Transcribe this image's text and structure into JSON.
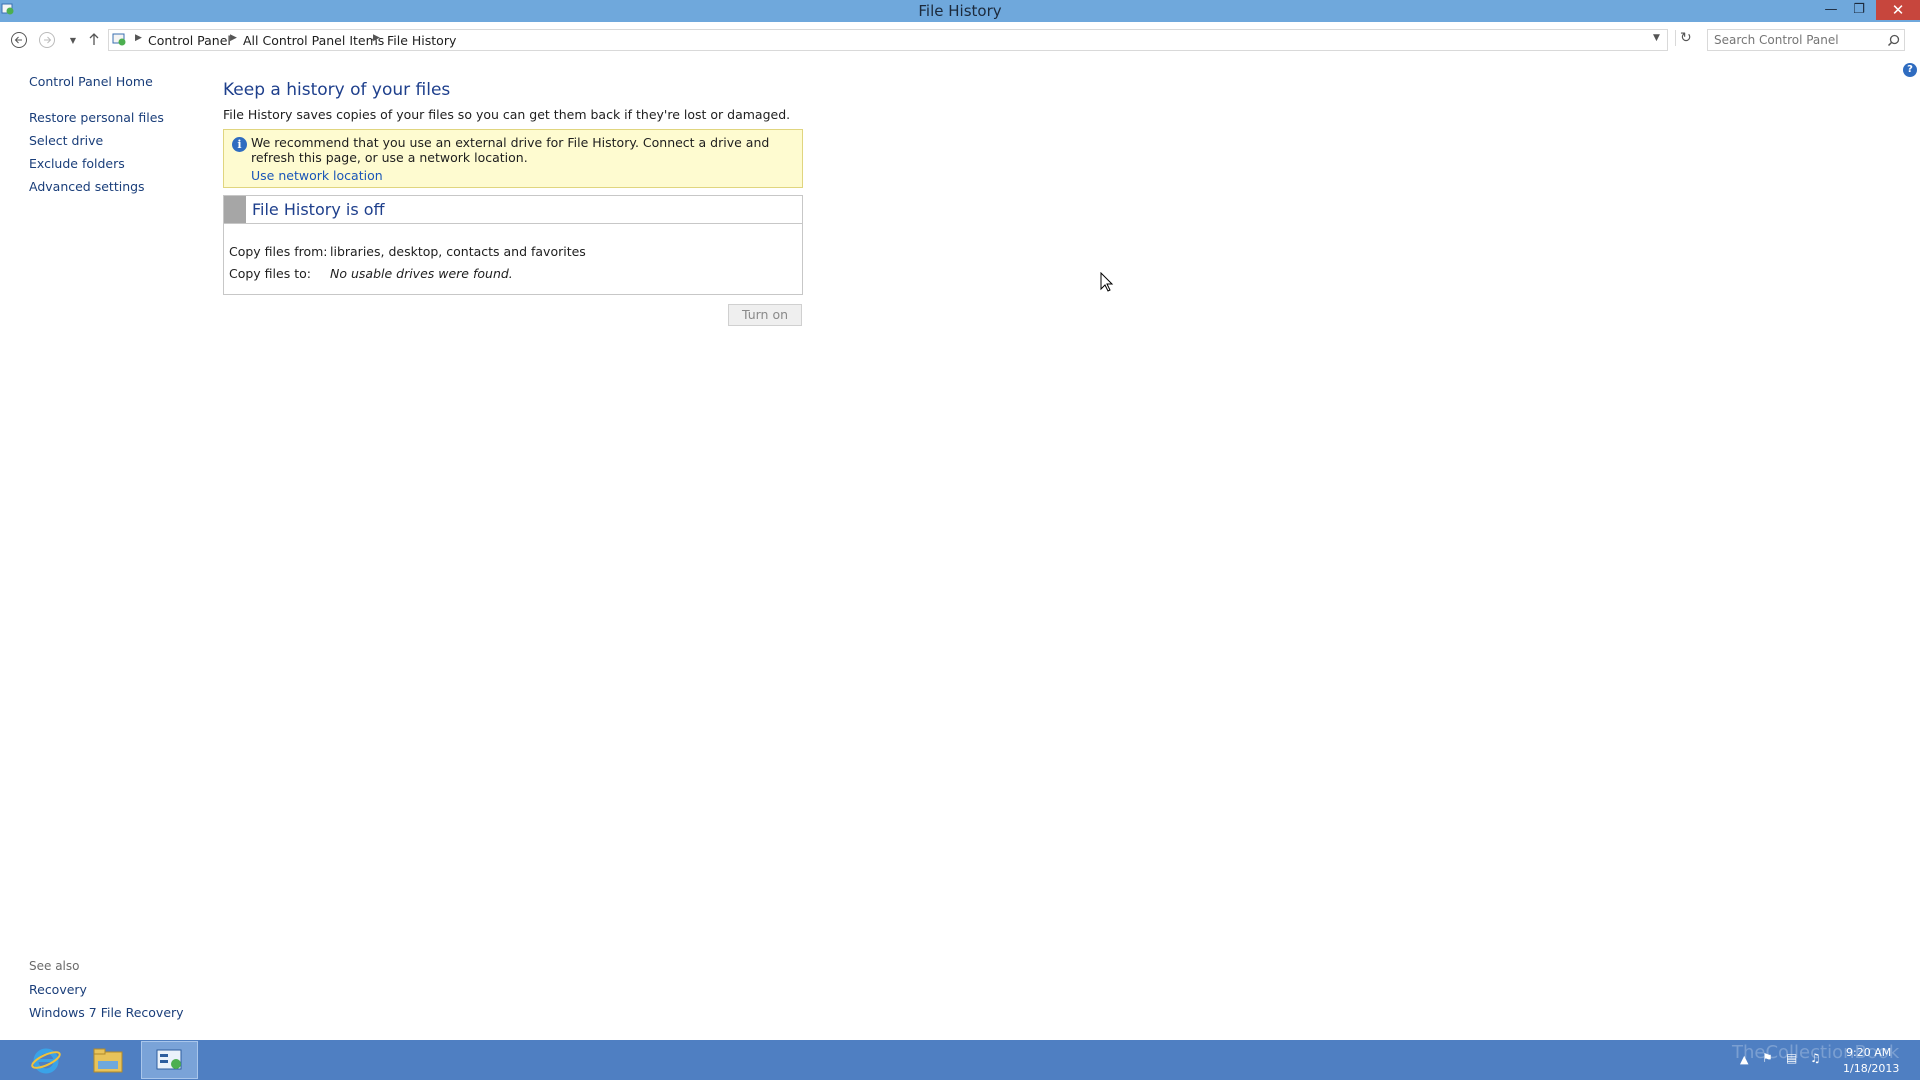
{
  "window": {
    "title": "File History"
  },
  "breadcrumb": {
    "items": [
      "Control Panel",
      "All Control Panel Items",
      "File History"
    ]
  },
  "search": {
    "placeholder": "Search Control Panel"
  },
  "sidebar": {
    "items": [
      {
        "label": "Control Panel Home"
      },
      {
        "label": "Restore personal files"
      },
      {
        "label": "Select drive"
      },
      {
        "label": "Exclude folders"
      },
      {
        "label": "Advanced settings"
      }
    ],
    "see_also_label": "See also",
    "see_also": [
      {
        "label": "Recovery"
      },
      {
        "label": "Windows 7 File Recovery"
      }
    ]
  },
  "main": {
    "heading": "Keep a history of your files",
    "description": "File History saves copies of your files so you can get them back if they're lost or damaged.",
    "info": {
      "message": "We recommend that you use an external drive for File History. Connect a drive and refresh this page, or use a network location.",
      "link": "Use network location"
    },
    "status": {
      "title": "File History is off",
      "copy_from_label": "Copy files from:",
      "copy_from_value": "libraries, desktop, contacts and favorites",
      "copy_to_label": "Copy files to:",
      "copy_to_value": "No usable drives were found."
    },
    "turn_on_label": "Turn on"
  },
  "taskbar": {
    "time": "9:20 AM",
    "date": "1/18/2013",
    "watermark": "TheCollectionBook"
  },
  "colors": {
    "titlebar": "#6fa8dc",
    "taskbar": "#4f7fc2",
    "link": "#1a3e7a",
    "heading": "#1e3f8c",
    "info_bg": "#fefbd0",
    "close": "#c7463d"
  }
}
